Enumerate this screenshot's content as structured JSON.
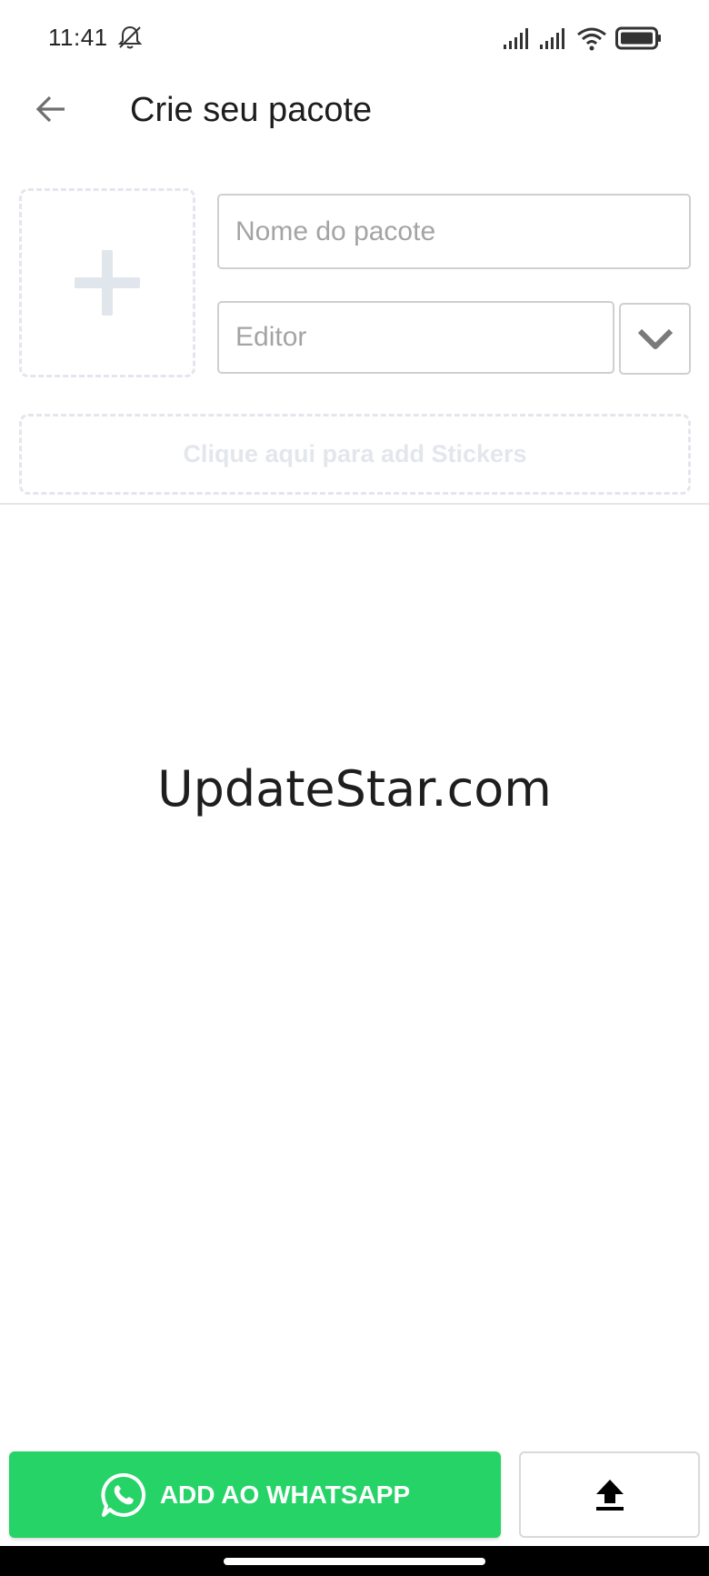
{
  "status_bar": {
    "time": "11:41",
    "icons": [
      "bell-off-icon",
      "signal-icon",
      "signal-icon",
      "wifi-icon",
      "battery-icon"
    ]
  },
  "app_bar": {
    "back_icon": "arrow-back-icon",
    "title": "Crie seu pacote"
  },
  "form": {
    "image_placeholder_icon": "plus-icon",
    "name_placeholder": "Nome do pacote",
    "name_value": "",
    "editor_placeholder": "Editor",
    "editor_value": "",
    "dropdown_icon": "chevron-down-icon",
    "add_stickers_label": "Clique aqui para add Stickers"
  },
  "watermark": "UpdateStar.com",
  "bottom": {
    "whatsapp_label": "ADD AO WHATSAPP",
    "whatsapp_icon": "whatsapp-icon",
    "upload_icon": "upload-icon"
  },
  "colors": {
    "whatsapp_green": "#26d367",
    "dashed_border": "#e3e6ec",
    "field_border": "#cfcfcf"
  }
}
